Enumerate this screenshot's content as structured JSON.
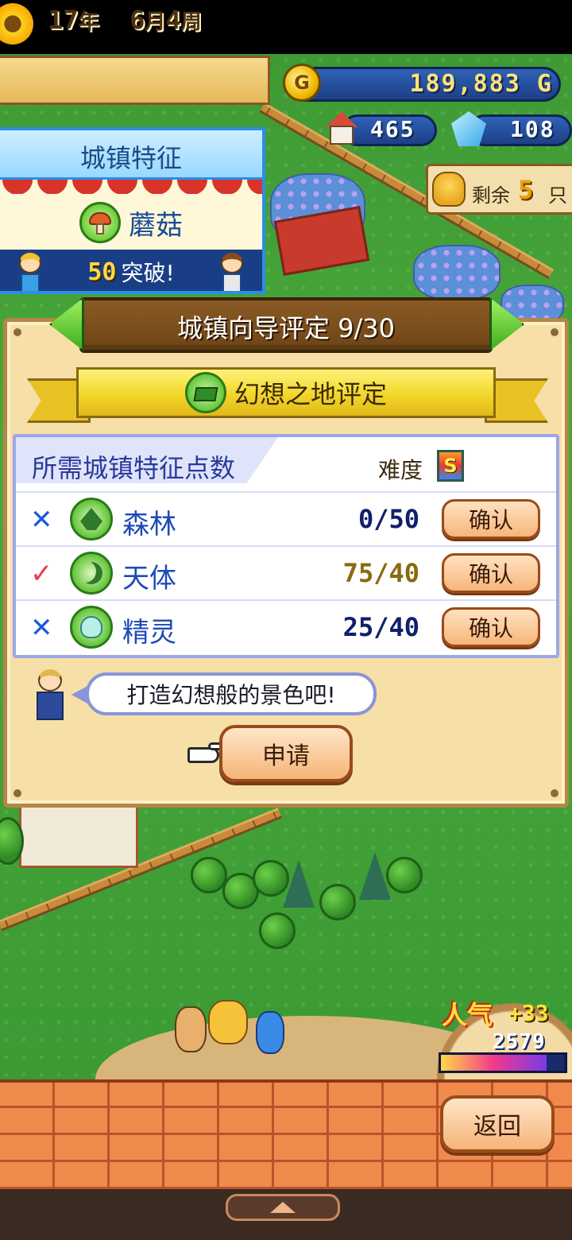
{
  "hud": {
    "year_num": "17",
    "year_unit": "年",
    "month_num": "6",
    "month_unit": "月",
    "week_num": "4",
    "week_unit": "周",
    "gold": "189,883 G",
    "coin_symbol": "G",
    "houses": "465",
    "crystals": "108",
    "remaining_label": "剩余",
    "remaining_count": "5",
    "remaining_unit": "只"
  },
  "feature_card": {
    "title": "城镇特征",
    "name": "蘑菇",
    "points": "50",
    "break_label": "突破!"
  },
  "dialog": {
    "header": "城镇向导评定 9/30",
    "ribbon": "幻想之地评定",
    "requirements_title": "所需城镇特征点数",
    "difficulty_label": "难度",
    "difficulty_rank": "S",
    "rows": [
      {
        "mark": "✕",
        "status": "unmet",
        "name": "森林",
        "count": "0/50",
        "button": "确认",
        "icon": "forest-icon"
      },
      {
        "mark": "✓",
        "status": "met",
        "name": "天体",
        "count": "75/40",
        "button": "确认",
        "icon": "moon-icon"
      },
      {
        "mark": "✕",
        "status": "unmet",
        "name": "精灵",
        "count": "25/40",
        "button": "确认",
        "icon": "spirit-icon"
      }
    ],
    "guide_message": "打造幻想般的景色吧!",
    "apply_button": "申请"
  },
  "popularity": {
    "label": "人气",
    "delta": "+33",
    "value": "2579",
    "fill_fraction": 0.85
  },
  "return_button": "返回",
  "colors": {
    "dialog_bg": "#f7dfa8",
    "accent_blue": "#2a8ee8",
    "confirm_orange": "#f7b57a",
    "unmet_mark": "#1e5ad8",
    "met_mark": "#e83a4a"
  }
}
